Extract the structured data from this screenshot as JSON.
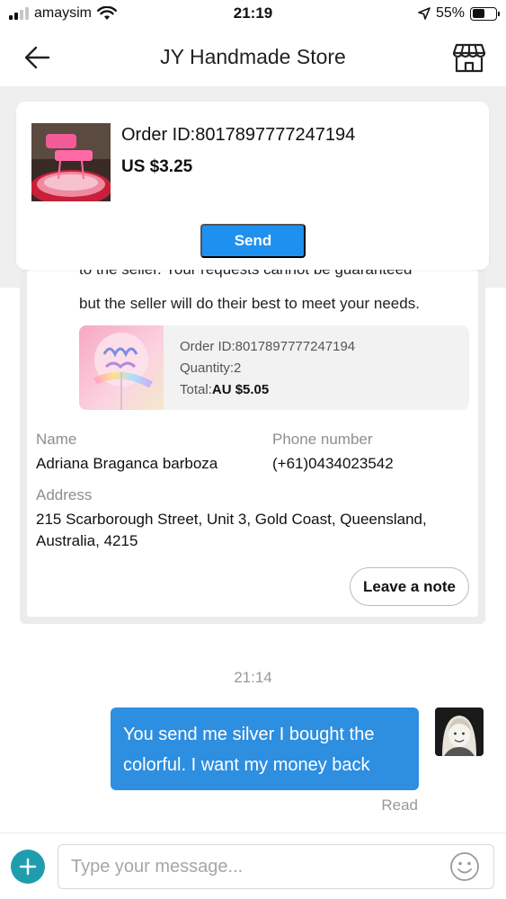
{
  "status_bar": {
    "carrier": "amaysim",
    "time": "21:19",
    "battery": "55%",
    "icons": [
      "signal-icon",
      "wifi-icon",
      "location-arrow-icon",
      "battery-icon"
    ]
  },
  "header": {
    "title": "JY Handmade Store",
    "icons": [
      "back-arrow-icon",
      "store-icon"
    ]
  },
  "pinned_order": {
    "order_id": "Order ID:8017897777247194",
    "price": "US $3.25",
    "send_label": "Send"
  },
  "order_card": {
    "partial_line": "to the seller. Your requests cannot be guaranteed",
    "notice_line": "but the seller will do their best to meet your needs.",
    "mini_order": {
      "order_id": "Order ID:8017897777247194",
      "quantity": "Quantity:2",
      "total_label": "Total:",
      "total_value": "AU $5.05"
    },
    "name_label": "Name",
    "name_value": "Adriana Braganca barboza",
    "phone_label": "Phone number",
    "phone_value": "(+61)0434023542",
    "address_label": "Address",
    "address_value": "215 Scarborough Street, Unit 3, Gold Coast, Queensland, Australia, 4215",
    "leave_note_label": "Leave a note"
  },
  "chat": {
    "timestamp": "21:14",
    "message": "You send me silver I bought the colorful. I want my money back",
    "read_status": "Read"
  },
  "composer": {
    "placeholder": "Type your message...",
    "icons": [
      "plus-icon",
      "emoji-icon"
    ]
  },
  "colors": {
    "accent_blue": "#1e90f0",
    "bubble_blue": "#2e8ee0",
    "plus_teal": "#1f9dad",
    "gray_bg": "#efefef"
  }
}
